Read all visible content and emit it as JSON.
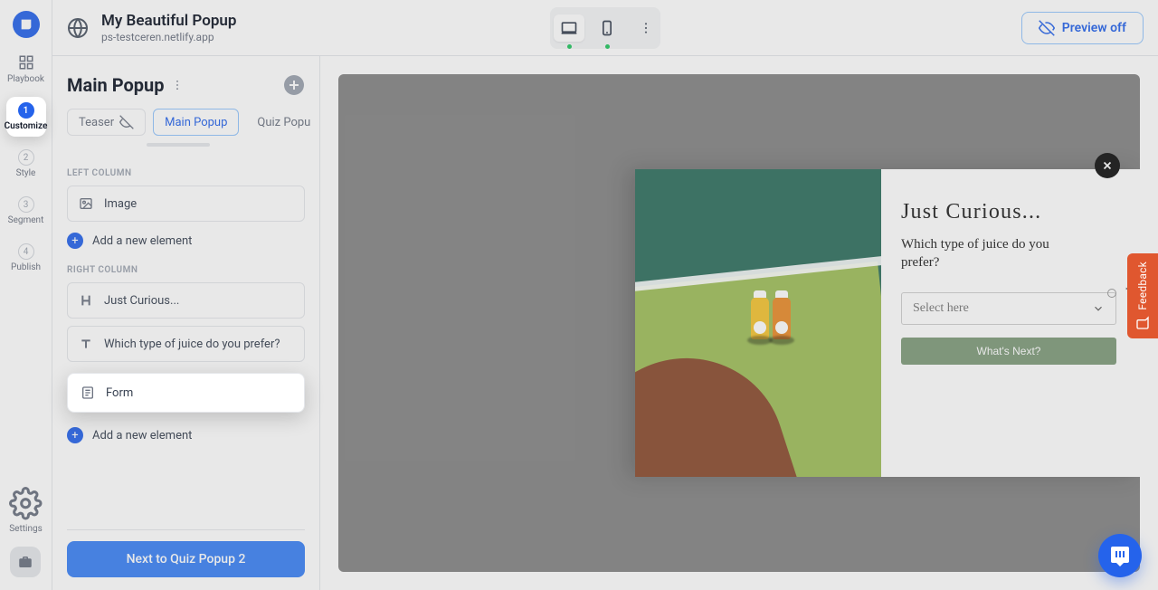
{
  "header": {
    "title": "My Beautiful Popup",
    "subtitle": "ps-testceren.netlify.app",
    "preview_label": "Preview off"
  },
  "rail": {
    "playbook": "Playbook",
    "settings": "Settings",
    "steps": [
      {
        "num": "1",
        "label": "Customize"
      },
      {
        "num": "2",
        "label": "Style"
      },
      {
        "num": "3",
        "label": "Segment"
      },
      {
        "num": "4",
        "label": "Publish"
      }
    ]
  },
  "panel": {
    "title": "Main Popup",
    "tabs": {
      "teaser": "Teaser",
      "main": "Main Popup",
      "quiz": "Quiz Popu"
    },
    "left_label": "LEFT COLUMN",
    "right_label": "RIGHT COLUMN",
    "image_elem": "Image",
    "heading_elem": "Just Curious...",
    "text_elem": "Which type of juice do you prefer?",
    "form_elem": "Form",
    "add_elem": "Add a new element",
    "next": "Next to Quiz Popup 2"
  },
  "popup": {
    "heading": "Just Curious...",
    "question": "Which type of juice do you prefer?",
    "select_placeholder": "Select here",
    "cta": "What's Next?"
  },
  "feedback_label": "Feedback"
}
